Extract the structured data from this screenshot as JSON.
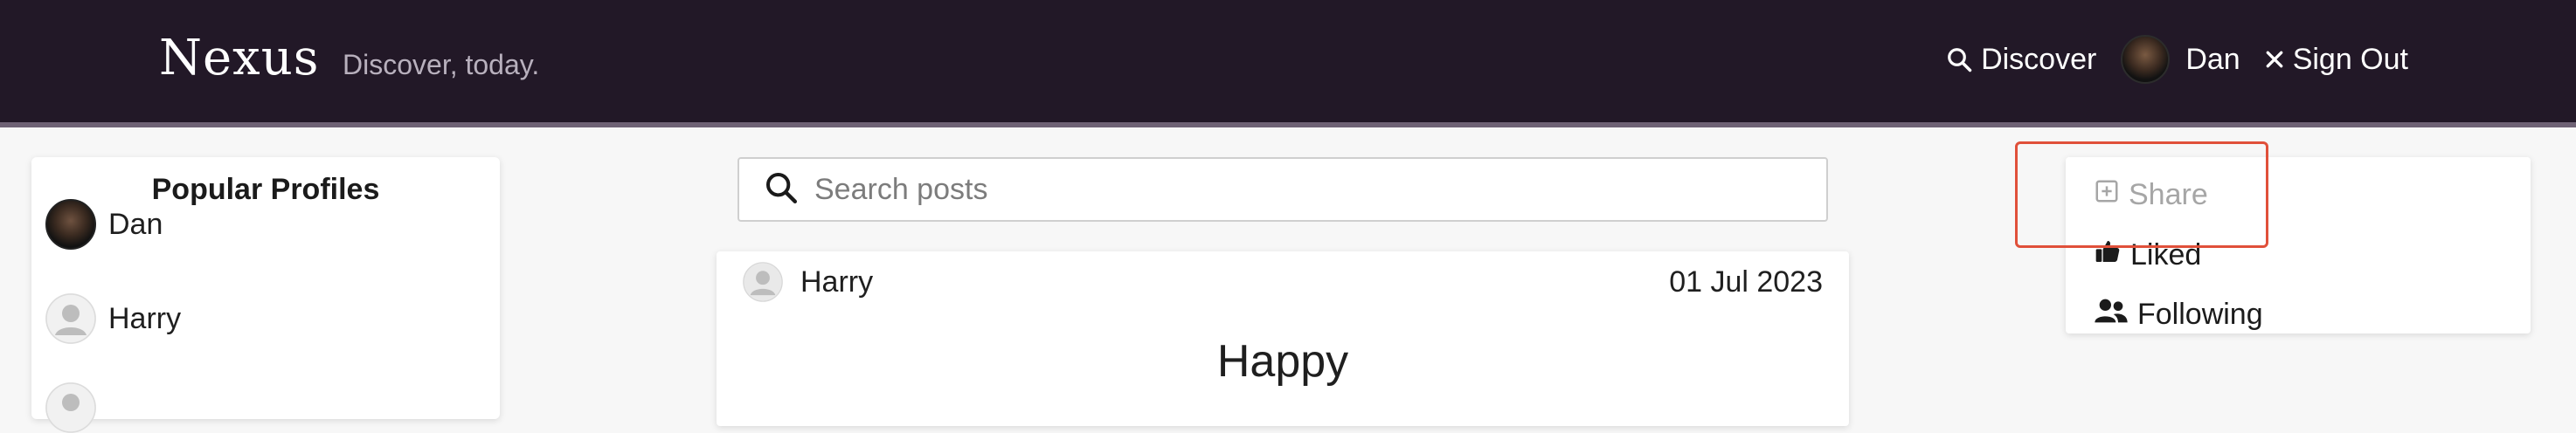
{
  "header": {
    "brand": "Nexus",
    "tagline": "Discover, today.",
    "discover_label": "Discover",
    "user_name": "Dan",
    "signout_label": "Sign Out"
  },
  "popular": {
    "title": "Popular Profiles",
    "profiles": [
      {
        "name": "Dan"
      },
      {
        "name": "Harry"
      }
    ]
  },
  "search": {
    "placeholder": "Search posts",
    "value": ""
  },
  "post": {
    "author": "Harry",
    "date": "01 Jul 2023",
    "title": "Happy"
  },
  "actions": {
    "share_label": "Share",
    "liked_label": "Liked",
    "following_label": "Following"
  },
  "colors": {
    "header_bg": "#221827",
    "highlight": "#e0503a"
  }
}
